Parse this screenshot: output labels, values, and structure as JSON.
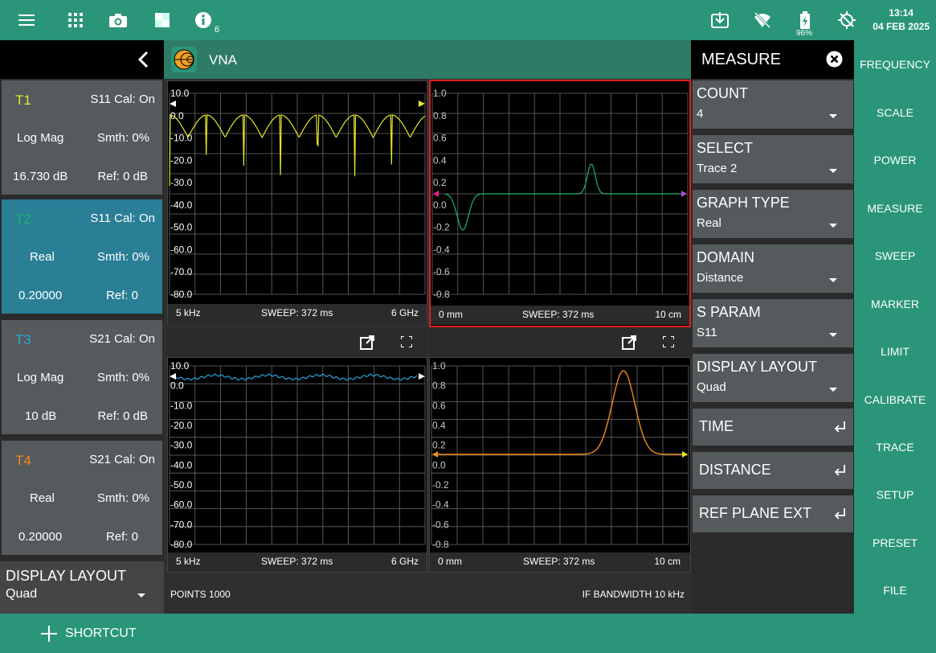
{
  "status_bar": {
    "info_badge": "6",
    "battery_percent": "96%",
    "time": "13:14",
    "date": "04 FEB 2025",
    "icons": [
      "menu-icon",
      "apps-grid-icon",
      "camera-icon",
      "display-mode-icon",
      "info-icon",
      "download-icon",
      "wifi-off-icon",
      "battery-icon",
      "gps-off-icon"
    ]
  },
  "colors": {
    "brand": "#2a9579",
    "t1": "#e6e62e",
    "t2": "#1fb36a",
    "t3": "#2aa6d9",
    "t4": "#f08c1e",
    "selected_border": "#e02020"
  },
  "traces": [
    {
      "name": "T1",
      "param": "S11 Cal: On",
      "format": "Log Mag",
      "smooth": "Smth: 0%",
      "marker_value": "16.730 dB",
      "ref": "Ref: 0 dB"
    },
    {
      "name": "T2",
      "param": "S11 Cal: On",
      "format": "Real",
      "smooth": "Smth: 0%",
      "marker_value": "0.20000",
      "ref": "Ref: 0"
    },
    {
      "name": "T3",
      "param": "S21 Cal: On",
      "format": "Log Mag",
      "smooth": "Smth: 0%",
      "marker_value": "10 dB",
      "ref": "Ref: 0 dB"
    },
    {
      "name": "T4",
      "param": "S21 Cal: On",
      "format": "Real",
      "smooth": "Smth: 0%",
      "marker_value": "0.20000",
      "ref": "Ref: 0"
    }
  ],
  "left_display_layout": {
    "label": "DISPLAY LAYOUT",
    "value": "Quad"
  },
  "app": {
    "title": "VNA"
  },
  "graphs": [
    {
      "start": "5 kHz",
      "sweep": "SWEEP: 372 ms",
      "stop": "6 GHz",
      "ticks": [
        "10.0",
        "0.0",
        "-10.0",
        "-20.0",
        "-30.0",
        "-40.0",
        "-50.0",
        "-60.0",
        "-70.0",
        "-80.0"
      ]
    },
    {
      "start": "0 mm",
      "sweep": "SWEEP: 372 ms",
      "stop": "10 cm",
      "ticks": [
        "1.0",
        "0.8",
        "0.6",
        "0.4",
        "0.2",
        "0.0",
        "-0.2",
        "-0.4",
        "-0.6",
        "-0.8"
      ]
    },
    {
      "start": "5 kHz",
      "sweep": "SWEEP: 372 ms",
      "stop": "6 GHz",
      "ticks": [
        "10.0",
        "0.0",
        "-10.0",
        "-20.0",
        "-30.0",
        "-40.0",
        "-50.0",
        "-60.0",
        "-70.0",
        "-80.0"
      ]
    },
    {
      "start": "0 mm",
      "sweep": "SWEEP: 372 ms",
      "stop": "10 cm",
      "ticks": [
        "1.0",
        "0.8",
        "0.6",
        "0.4",
        "0.2",
        "0.0",
        "-0.2",
        "-0.4",
        "-0.6",
        "-0.8"
      ]
    }
  ],
  "footer": {
    "points": "POINTS 1000",
    "if_bw": "IF BANDWIDTH 10 kHz"
  },
  "measure_panel": {
    "title": "MEASURE",
    "dropdowns": [
      {
        "label": "COUNT",
        "value": "4"
      },
      {
        "label": "SELECT",
        "value": "Trace 2"
      },
      {
        "label": "GRAPH TYPE",
        "value": "Real"
      },
      {
        "label": "DOMAIN",
        "value": "Distance"
      },
      {
        "label": "S PARAM",
        "value": "S11"
      },
      {
        "label": "DISPLAY LAYOUT",
        "value": "Quad"
      }
    ],
    "actions": [
      "TIME",
      "DISTANCE",
      "REF PLANE EXT"
    ]
  },
  "side_menu": [
    "FREQUENCY",
    "SCALE",
    "POWER",
    "MEASURE",
    "SWEEP",
    "MARKER",
    "LIMIT",
    "CALIBRATE",
    "TRACE",
    "SETUP",
    "PRESET",
    "FILE"
  ],
  "bottom": {
    "shortcut": "SHORTCUT"
  }
}
